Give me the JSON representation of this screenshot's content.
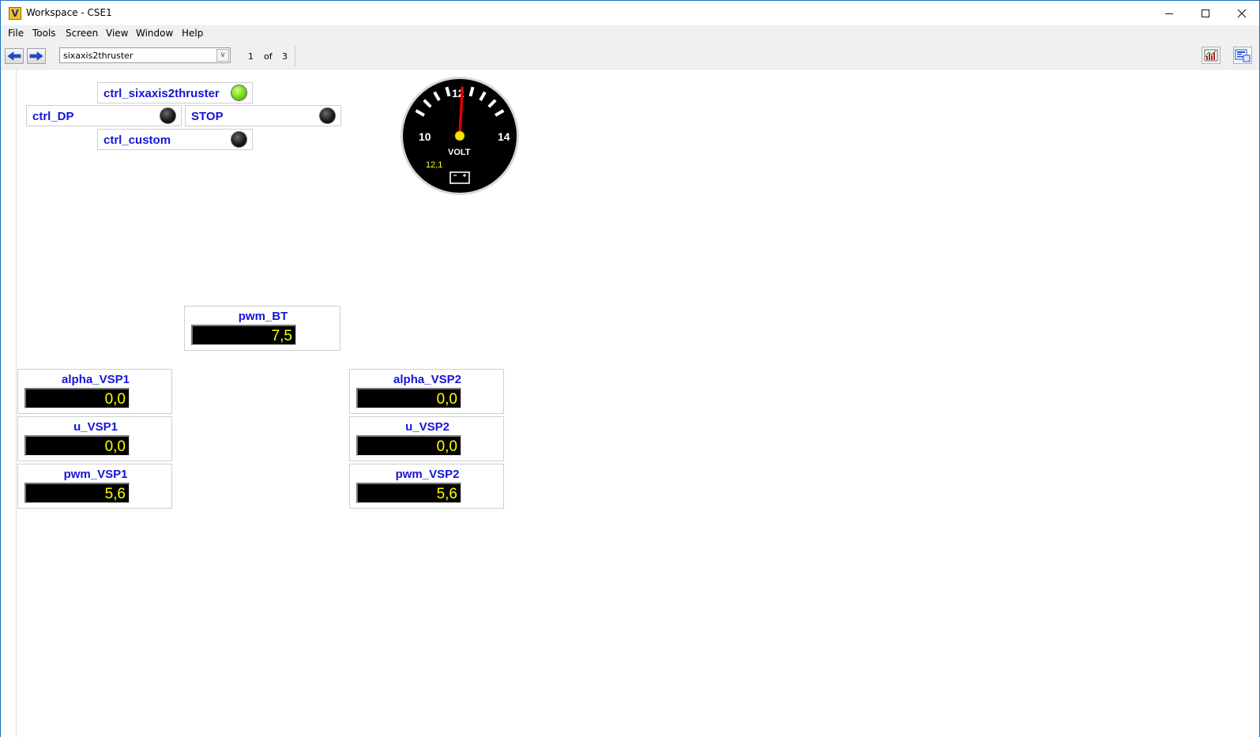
{
  "window": {
    "title": "Workspace - CSE1",
    "app_icon_letter": "V",
    "minimize_icon": "minimize-icon",
    "maximize_icon": "maximize-icon",
    "close_icon": "close-icon"
  },
  "menu": [
    "File",
    "Tools",
    "Screen",
    "View",
    "Window",
    "Help"
  ],
  "toolbar": {
    "back_icon": "arrow-left-icon",
    "forward_icon": "arrow-right-icon",
    "screen_select_value": "sixaxis2thruster",
    "page_current": "1",
    "page_of": "of",
    "page_total": "3",
    "graph_icon": "graph-icon",
    "probe_icon": "probe-icon"
  },
  "indicators": {
    "ctrl_sixaxis2thruster": {
      "label": "ctrl_sixaxis2thruster",
      "state": "on",
      "color": "#6ee01a"
    },
    "ctrl_DP": {
      "label": "ctrl_DP",
      "state": "off"
    },
    "STOP": {
      "label": "STOP",
      "state": "off"
    },
    "ctrl_custom": {
      "label": "ctrl_custom",
      "state": "off"
    }
  },
  "gauge": {
    "unit_label": "VOLT",
    "tick_min": "10",
    "tick_mid": "12",
    "tick_max": "14",
    "scale_min": 10,
    "scale_max": 14,
    "value": 12.1,
    "value_text": "12,1",
    "battery_icon": "battery-icon",
    "needle_color": "#e00000"
  },
  "numerics": {
    "pwm_BT": {
      "label": "pwm_BT",
      "value": "7,5"
    },
    "alpha_VSP1": {
      "label": "alpha_VSP1",
      "value": "0,0"
    },
    "u_VSP1": {
      "label": "u_VSP1",
      "value": "0,0"
    },
    "pwm_VSP1": {
      "label": "pwm_VSP1",
      "value": "5,6"
    },
    "alpha_VSP2": {
      "label": "alpha_VSP2",
      "value": "0,0"
    },
    "u_VSP2": {
      "label": "u_VSP2",
      "value": "0,0"
    },
    "pwm_VSP2": {
      "label": "pwm_VSP2",
      "value": "5,6"
    }
  },
  "colors": {
    "label_blue": "#1515d8",
    "display_text": "#ffff00",
    "display_bg": "#000000"
  }
}
